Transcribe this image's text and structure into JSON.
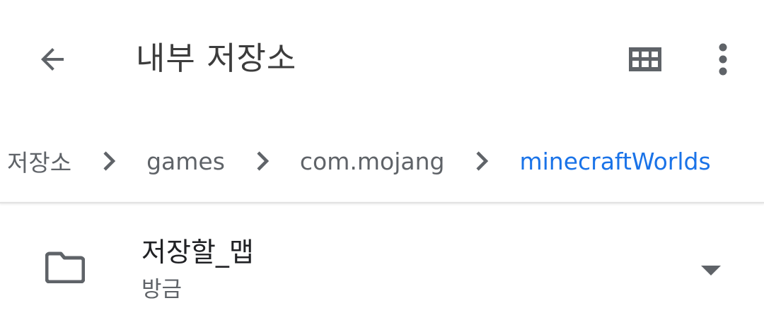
{
  "appbar": {
    "title": "내부 저장소",
    "back_icon": "arrow-back-icon",
    "grid_icon": "grid-view-icon",
    "more_icon": "more-vert-icon"
  },
  "breadcrumb": {
    "items": [
      {
        "label": "저장소",
        "current": false
      },
      {
        "label": "games",
        "current": false
      },
      {
        "label": "com.mojang",
        "current": false
      },
      {
        "label": "minecraftWorlds",
        "current": true
      }
    ],
    "separator_icon": "chevron-right-icon"
  },
  "list": {
    "items": [
      {
        "name": "저장할_맵",
        "subtitle": "방금",
        "icon": "folder-icon",
        "action_icon": "arrow-drop-down-icon"
      }
    ]
  },
  "colors": {
    "icon": "#5f6368",
    "text_primary": "#202124",
    "text_secondary": "#5f6368",
    "accent": "#1a73e8",
    "background": "#ffffff"
  }
}
